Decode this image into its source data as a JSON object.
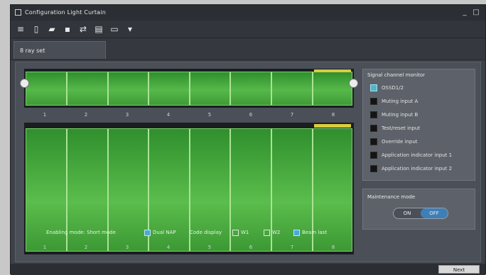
{
  "window": {
    "title": "Configuration Light Curtain",
    "controls": [
      "_",
      "□"
    ]
  },
  "toolbar": {
    "icons": [
      "menu-icon",
      "new-file-icon",
      "open-folder-icon",
      "save-icon",
      "network-icon",
      "device-icon",
      "monitor-icon",
      "download-icon"
    ]
  },
  "tab": {
    "label": "8 ray set"
  },
  "beams": {
    "numbers": [
      "1",
      "2",
      "3",
      "4",
      "5",
      "6",
      "7",
      "8"
    ],
    "selected": "8"
  },
  "control_row": {
    "label_mode": "Enabling mode: Short mode",
    "label_mode_value": "Dual NAP",
    "label_display": "Code display",
    "opt1": "W1",
    "opt2": "W2",
    "opt3": "Beam last"
  },
  "signals": {
    "header": "Signal channel monitor",
    "items": [
      {
        "label": "OSSD1/2",
        "on": true
      },
      {
        "label": "Muting input A",
        "on": false
      },
      {
        "label": "Muting input B",
        "on": false
      },
      {
        "label": "Test/reset input",
        "on": false
      },
      {
        "label": "Override input",
        "on": false
      },
      {
        "label": "Application indicator input 1",
        "on": false
      },
      {
        "label": "Application indicator input 2",
        "on": false
      }
    ]
  },
  "maintenance": {
    "header": "Maintenance mode",
    "on_label": "ON",
    "off_label": "OFF",
    "selected": "OFF"
  },
  "status": {
    "button_label": "Next"
  },
  "colors": {
    "beam_green": "#57b84a",
    "beam_selected": "#d9cc3f",
    "accent_blue": "#3f7fb8"
  }
}
